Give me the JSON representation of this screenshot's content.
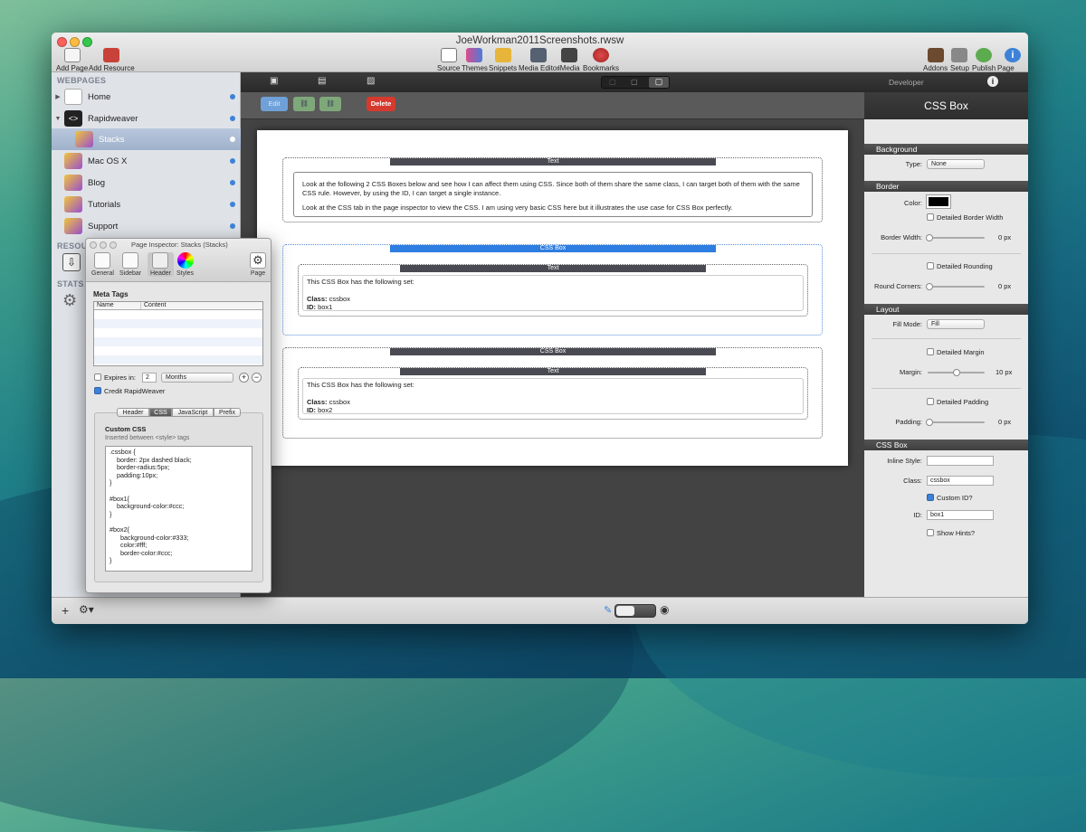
{
  "window": {
    "title": "JoeWorkman2011Screenshots.rwsw"
  },
  "toolbar": {
    "left": [
      {
        "label": "Add Page"
      },
      {
        "label": "Add Resource"
      }
    ],
    "center": [
      {
        "label": "Source"
      },
      {
        "label": "Themes"
      },
      {
        "label": "Snippets"
      },
      {
        "label": "Media Editor"
      },
      {
        "label": "iMedia"
      },
      {
        "label": "Bookmarks"
      }
    ],
    "right": [
      {
        "label": "Addons"
      },
      {
        "label": "Setup"
      },
      {
        "label": "Publish"
      },
      {
        "label": "Page Info"
      }
    ]
  },
  "sidebar": {
    "webpages_header": "WEBPAGES",
    "pages": [
      {
        "label": "Home",
        "icon": "home-icon"
      },
      {
        "label": "Rapidweaver",
        "icon": "code-icon"
      },
      {
        "label": "Stacks",
        "icon": "stacks-cube-icon"
      },
      {
        "label": "Mac OS X",
        "icon": "stacks-cube-icon"
      },
      {
        "label": "Blog",
        "icon": "stacks-cube-icon"
      },
      {
        "label": "Tutorials",
        "icon": "stacks-cube-icon"
      },
      {
        "label": "Support",
        "icon": "stacks-cube-icon"
      }
    ],
    "resources_header": "RESOURC",
    "stats_header": "STATS"
  },
  "editor": {
    "edit_buttons": [
      "Edit",
      "Delete"
    ],
    "content": {
      "text_bar": "Text",
      "intro_p1": "Look at the following 2 CSS Boxes below and see how I can affect them using CSS. Since both of them share the same class, I can target both of them with the same CSS rule. However, by using the ID, I can target a single instance.",
      "intro_p2": "Look at the CSS tab in the page inspector to view the CSS. I am using very basic CSS here but it illustrates the use case for CSS Box perfectly.",
      "boxes": [
        {
          "bar": "CSS Box",
          "text_bar": "Text",
          "line": "This CSS Box has the following set:",
          "class_label": "Class:",
          "class_value": "cssbox",
          "id_label": "ID:",
          "id_value": "box1"
        },
        {
          "bar": "CSS Box",
          "text_bar": "Text",
          "line": "This CSS Box has the following set:",
          "class_label": "Class:",
          "class_value": "cssbox",
          "id_label": "ID:",
          "id_value": "box2"
        }
      ]
    }
  },
  "inspector": {
    "header_label": "Developer",
    "title": "CSS Box",
    "background": {
      "section": "Background",
      "type_label": "Type:",
      "type_value": "None"
    },
    "border": {
      "section": "Border",
      "color_label": "Color:",
      "detailed_width": "Detailed Border Width",
      "width_label": "Border Width:",
      "width_value": "0 px",
      "detailed_rounding": "Detailed Rounding",
      "corners_label": "Round Corners:",
      "corners_value": "0 px"
    },
    "layout": {
      "section": "Layout",
      "fill_label": "Fill Mode:",
      "fill_value": "Fill",
      "detailed_margin": "Detailed Margin",
      "margin_label": "Margin:",
      "margin_value": "10 px",
      "margin_level": 0.5,
      "detailed_padding": "Detailed Padding",
      "padding_label": "Padding:",
      "padding_value": "0 px"
    },
    "cssbox": {
      "section": "CSS Box",
      "inline_label": "Inline Style:",
      "inline_value": "",
      "class_label": "Class:",
      "class_value": "cssbox",
      "custom_id": "Custom ID?",
      "id_label": "ID:",
      "id_value": "box1",
      "hints": "Show Hints?"
    }
  },
  "page_inspector": {
    "title": "Page Inspector: Stacks (Stacks)",
    "tabs": [
      "General",
      "Sidebar",
      "Header",
      "Styles",
      "Page"
    ],
    "meta_tags": "Meta Tags",
    "columns": [
      "Name",
      "Content"
    ],
    "expires_label": "Expires in:",
    "expires_value": "2",
    "expires_unit": "Months",
    "credit": "Credit RapidWeaver",
    "subtabs": [
      "Header",
      "CSS",
      "JavaScript",
      "Prefix"
    ],
    "custom_css": "Custom CSS",
    "custom_css_hint": "Inserted between <style> tags",
    "css_code": ".cssbox {\n    border: 2px dashed black;\n    border-radius:5px;\n    padding:10px;\n}\n\n#box1{\n    background-color:#ccc;\n}\n\n#box2{\n      background-color:#333;\n      color:#fff;\n      border-color:#ccc;\n}"
  },
  "colors": {
    "accent": "#3d82d8",
    "delete": "#d63a2e"
  }
}
